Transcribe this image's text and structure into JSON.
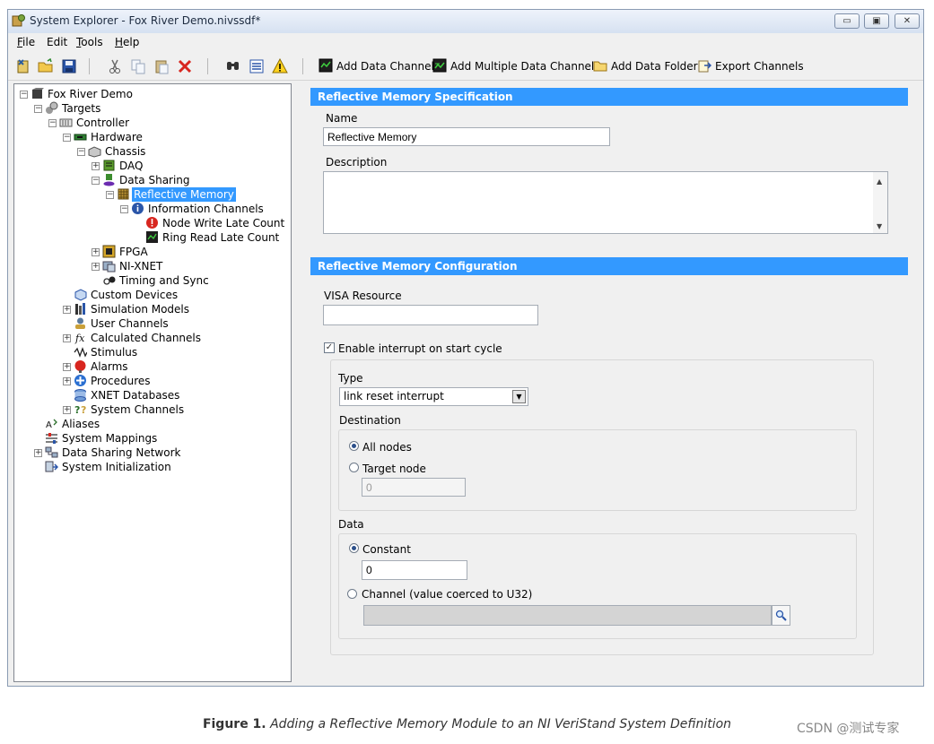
{
  "window": {
    "title": "System Explorer - Fox River Demo.nivssdf*",
    "buttons": {
      "minimize": "▭",
      "maximize": "▣",
      "close": "✕"
    }
  },
  "menu": [
    {
      "label": "File",
      "accel": "F",
      "rest": "ile"
    },
    {
      "label": "Edit",
      "accel": "",
      "rest": "Edit"
    },
    {
      "label": "Tools",
      "accel": "T",
      "rest": "ools"
    },
    {
      "label": "Help",
      "accel": "H",
      "rest": "elp"
    }
  ],
  "toolbar": {
    "icons": [
      "new-file-icon",
      "open-folder-icon",
      "save-icon",
      "cut-icon",
      "copy-icon",
      "paste-icon",
      "delete-icon",
      "find-icon",
      "list-icon",
      "warning-icon"
    ],
    "add_data_channel": "Add Data Channel",
    "add_multiple_data_channels": "Add Multiple Data Channels",
    "add_data_folder": "Add Data Folder",
    "export_channels": "Export Channels"
  },
  "tree": [
    {
      "label": "Fox River Demo",
      "exp": "−",
      "icon": "box-icon"
    },
    {
      "label": "Targets",
      "exp": "−",
      "icon": "targets-icon"
    },
    {
      "label": "Controller",
      "exp": "−",
      "icon": "controller-icon"
    },
    {
      "label": "Hardware",
      "exp": "−",
      "icon": "hardware-icon"
    },
    {
      "label": "Chassis",
      "exp": "−",
      "icon": "chassis-icon"
    },
    {
      "label": "DAQ",
      "exp": "+",
      "icon": "daq-icon"
    },
    {
      "label": "Data Sharing",
      "exp": "−",
      "icon": "data-sharing-icon"
    },
    {
      "label": "Reflective Memory",
      "exp": "−",
      "icon": "reflective-memory-icon",
      "selected": true
    },
    {
      "label": "Information Channels",
      "exp": "−",
      "icon": "info-icon"
    },
    {
      "label": "Node Write Late Count",
      "exp": "",
      "icon": "error-icon"
    },
    {
      "label": "Ring Read Late Count",
      "exp": "",
      "icon": "channel-icon"
    },
    {
      "label": "FPGA",
      "exp": "+",
      "icon": "fpga-icon"
    },
    {
      "label": "NI-XNET",
      "exp": "+",
      "icon": "xnet-icon"
    },
    {
      "label": "Timing and Sync",
      "exp": "",
      "icon": "timing-icon"
    },
    {
      "label": "Custom Devices",
      "exp": "",
      "icon": "custom-devices-icon"
    },
    {
      "label": "Simulation Models",
      "exp": "+",
      "icon": "simulation-icon"
    },
    {
      "label": "User Channels",
      "exp": "",
      "icon": "user-channels-icon"
    },
    {
      "label": "Calculated Channels",
      "exp": "+",
      "icon": "fx-icon"
    },
    {
      "label": "Stimulus",
      "exp": "",
      "icon": "stimulus-icon"
    },
    {
      "label": "Alarms",
      "exp": "+",
      "icon": "alarm-icon"
    },
    {
      "label": "Procedures",
      "exp": "+",
      "icon": "procedures-icon"
    },
    {
      "label": "XNET Databases",
      "exp": "",
      "icon": "database-icon"
    },
    {
      "label": "System Channels",
      "exp": "+",
      "icon": "system-channels-icon"
    },
    {
      "label": "Aliases",
      "exp": "",
      "icon": "aliases-icon"
    },
    {
      "label": "System Mappings",
      "exp": "",
      "icon": "mappings-icon"
    },
    {
      "label": "Data Sharing Network",
      "exp": "+",
      "icon": "network-icon"
    },
    {
      "label": "System Initialization",
      "exp": "",
      "icon": "init-icon"
    }
  ],
  "spec": {
    "header": "Reflective Memory Specification",
    "name_label": "Name",
    "name_value": "Reflective Memory",
    "description_label": "Description",
    "description_value": ""
  },
  "config": {
    "header": "Reflective Memory Configuration",
    "visa_label": "VISA Resource",
    "visa_value": "",
    "enable_interrupt_label": "Enable interrupt on start cycle",
    "enable_interrupt_checked": true,
    "type_label": "Type",
    "type_value": "link reset interrupt",
    "destination_label": "Destination",
    "all_nodes_label": "All nodes",
    "target_node_label": "Target node",
    "target_node_value": "0",
    "data_label": "Data",
    "constant_label": "Constant",
    "constant_value": "0",
    "channel_label": "Channel (value coerced to U32)",
    "channel_value": ""
  },
  "caption": {
    "figure": "Figure 1.",
    "text": " Adding a Reflective Memory Module to an NI VeriStand System Definition"
  },
  "watermark": "CSDN @测试专家"
}
